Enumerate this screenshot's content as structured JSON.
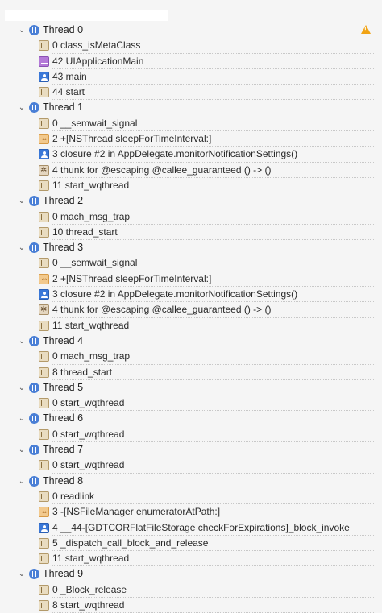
{
  "threads": [
    {
      "label": "Thread 0",
      "warning": true,
      "frames": [
        {
          "label": "0 class_isMetaClass",
          "icon": "library"
        },
        {
          "label": "42 UIApplicationMain",
          "icon": "uikit"
        },
        {
          "label": "43 main",
          "icon": "user"
        },
        {
          "label": "44 start",
          "icon": "library"
        }
      ]
    },
    {
      "label": "Thread 1",
      "frames": [
        {
          "label": "0 __semwait_signal",
          "icon": "library"
        },
        {
          "label": "2 +[NSThread sleepForTimeInterval:]",
          "icon": "thread-sys"
        },
        {
          "label": "3 closure #2 in AppDelegate.monitorNotificationSettings()",
          "icon": "user"
        },
        {
          "label": "4 thunk for @escaping @callee_guaranteed () -> ()",
          "icon": "thunk"
        },
        {
          "label": "11 start_wqthread",
          "icon": "library"
        }
      ]
    },
    {
      "label": "Thread 2",
      "frames": [
        {
          "label": "0 mach_msg_trap",
          "icon": "library"
        },
        {
          "label": "10 thread_start",
          "icon": "library"
        }
      ]
    },
    {
      "label": "Thread 3",
      "frames": [
        {
          "label": "0 __semwait_signal",
          "icon": "library"
        },
        {
          "label": "2 +[NSThread sleepForTimeInterval:]",
          "icon": "thread-sys"
        },
        {
          "label": "3 closure #2 in AppDelegate.monitorNotificationSettings()",
          "icon": "user"
        },
        {
          "label": "4 thunk for @escaping @callee_guaranteed () -> ()",
          "icon": "thunk"
        },
        {
          "label": "11 start_wqthread",
          "icon": "library"
        }
      ]
    },
    {
      "label": "Thread 4",
      "frames": [
        {
          "label": "0 mach_msg_trap",
          "icon": "library"
        },
        {
          "label": "8 thread_start",
          "icon": "library"
        }
      ]
    },
    {
      "label": "Thread 5",
      "frames": [
        {
          "label": "0 start_wqthread",
          "icon": "library"
        }
      ]
    },
    {
      "label": "Thread 6",
      "frames": [
        {
          "label": "0 start_wqthread",
          "icon": "library"
        }
      ]
    },
    {
      "label": "Thread 7",
      "frames": [
        {
          "label": "0 start_wqthread",
          "icon": "library"
        }
      ]
    },
    {
      "label": "Thread 8",
      "frames": [
        {
          "label": "0 readlink",
          "icon": "library"
        },
        {
          "label": "3 -[NSFileManager enumeratorAtPath:]",
          "icon": "thread-sys"
        },
        {
          "label": "4 __44-[GDTCORFlatFileStorage checkForExpirations]_block_invoke",
          "icon": "user"
        },
        {
          "label": "5 _dispatch_call_block_and_release",
          "icon": "library"
        },
        {
          "label": "11 start_wqthread",
          "icon": "library"
        }
      ]
    },
    {
      "label": "Thread 9",
      "frames": [
        {
          "label": "0 _Block_release",
          "icon": "library"
        },
        {
          "label": "8 start_wqthread",
          "icon": "library"
        }
      ]
    }
  ],
  "colors": {
    "thread_icon": "#4a7fd6",
    "warning": "#f1a314"
  }
}
